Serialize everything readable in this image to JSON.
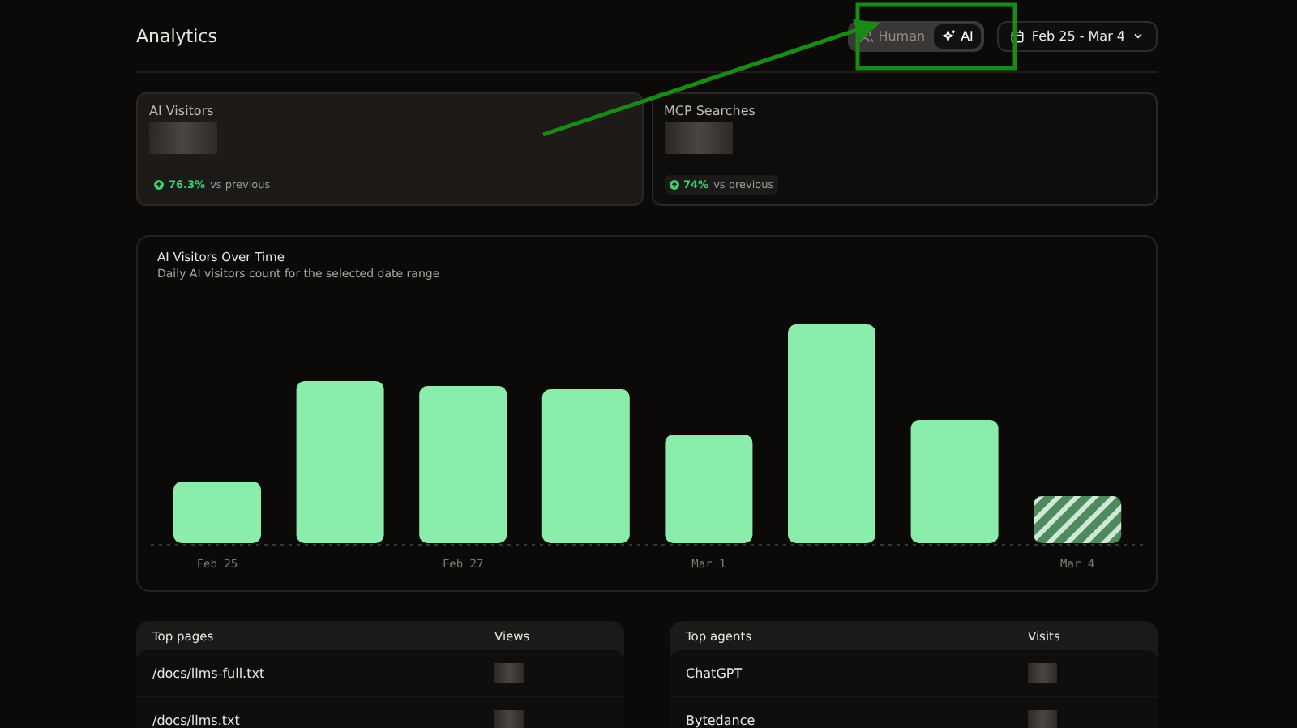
{
  "header": {
    "title": "Analytics",
    "toggle": [
      {
        "label": "Human",
        "selected": false
      },
      {
        "label": "AI",
        "selected": true
      }
    ],
    "date_range": "Feb 25 - Mar 4"
  },
  "stats": [
    {
      "label": "AI Visitors",
      "change": "76.3%",
      "change_suffix": "vs previous",
      "selected": true
    },
    {
      "label": "MCP Searches",
      "change": "74%",
      "change_suffix": "vs previous",
      "selected": false
    }
  ],
  "chart": {
    "title": "AI Visitors Over Time",
    "subtitle": "Daily AI visitors count for the selected date range",
    "x_labels": [
      "Feb 25",
      "Feb 27",
      "Mar 1",
      "Mar 4"
    ]
  },
  "tables": [
    {
      "columns": [
        "Top pages",
        "Views"
      ],
      "rows": [
        "/docs/llms-full.txt",
        "/docs/llms.txt"
      ]
    },
    {
      "columns": [
        "Top agents",
        "Visits"
      ],
      "rows": [
        "ChatGPT",
        "Bytedance"
      ]
    }
  ]
}
